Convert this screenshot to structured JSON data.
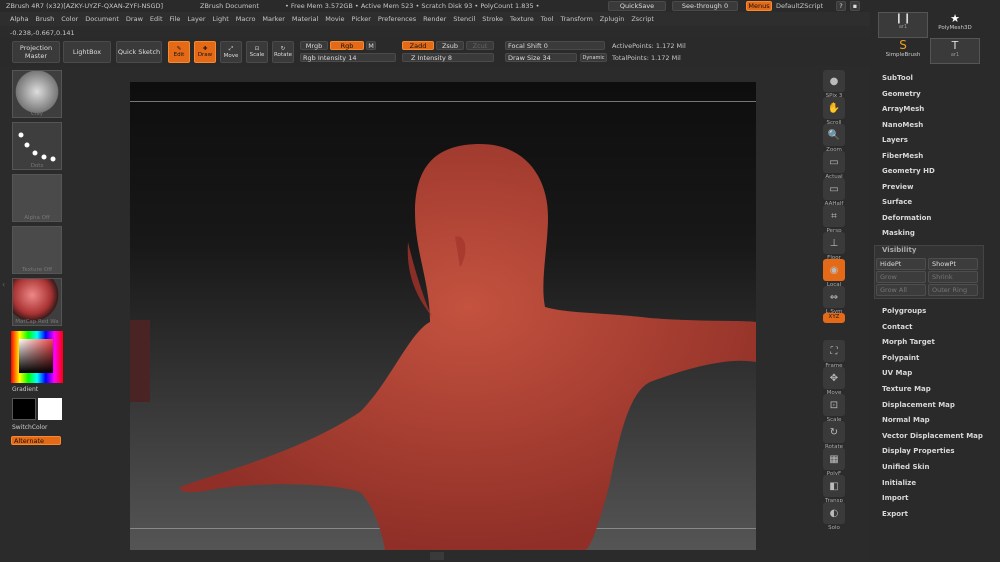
{
  "title": {
    "app": "ZBrush 4R7  (x32)[AZKY-UYZF-QXAN-ZYFI-NSGD]",
    "doc": "ZBrush Document",
    "stats": "• Free Mem 3.572GB • Active Mem 523 • Scratch Disk 93 • PolyCount 1.835 •",
    "quicksave": "QuickSave",
    "seethrough": "See-through  0",
    "menus": "Menus",
    "zscript": "DefaultZScript"
  },
  "menu": [
    "Alpha",
    "Brush",
    "Color",
    "Document",
    "Draw",
    "Edit",
    "File",
    "Layer",
    "Light",
    "Macro",
    "Marker",
    "Material",
    "Movie",
    "Picker",
    "Preferences",
    "Render",
    "Stencil",
    "Stroke",
    "Texture",
    "Tool",
    "Transform",
    "Zplugin",
    "Zscript"
  ],
  "coords": "-0.238,-0.667,0.141",
  "toolbar": {
    "projection": "Projection Master",
    "lightbox": "LightBox",
    "quicksketch": "Quick Sketch",
    "edit": "Edit",
    "draw": "Draw",
    "move": "Move",
    "scale": "Scale",
    "rotate": "Rotate",
    "mrgb": "Mrgb",
    "rgb": "Rgb",
    "m": "M",
    "rgb_intensity": "Rgb  Intensity 14",
    "zadd": "Zadd",
    "zsub": "Zsub",
    "zcut": "Zcut",
    "z_intensity": "Z  Intensity 8",
    "focal": "Focal Shift 0",
    "drawsize": "Draw Size 34",
    "dynamic": "Dynamic",
    "active_points": "ActivePoints: 1.172 Mil",
    "total_points": "TotalPoints: 1.172 Mil"
  },
  "left": {
    "thumbs": [
      "Clay",
      "Dots",
      "Alpha Off",
      "Texture Off",
      "MatCap Red Wa"
    ],
    "gradient": "Gradient",
    "switchcolor": "SwitchColor",
    "alternate": "Alternate"
  },
  "right_tools": [
    "SPix 3",
    "Scroll",
    "Zoom",
    "Actual",
    "AAHalf",
    "Persp",
    "Floor",
    "Local",
    "L.Sym",
    "XYZ",
    "Frame",
    "Move",
    "Scale",
    "Rotate",
    "PolyF",
    "Transp",
    "Solo"
  ],
  "tool_thumbs": [
    "ar1",
    "PolyMesh3D",
    "SimpleBrush",
    "ar1"
  ],
  "panel": {
    "items_top": [
      "SubTool",
      "Geometry",
      "ArrayMesh",
      "NanoMesh",
      "Layers",
      "FiberMesh",
      "Geometry HD",
      "Preview",
      "Surface",
      "Deformation",
      "Masking"
    ],
    "visibility": "Visibility",
    "hidept": "HidePt",
    "showpt": "ShowPt",
    "grow": "Grow",
    "shrink": "Shrink",
    "growall": "Grow All",
    "outerring": "Outer Ring",
    "items_bottom": [
      "Polygroups",
      "Contact",
      "Morph Target",
      "Polypaint",
      "UV Map",
      "Texture Map",
      "Displacement Map",
      "Normal Map",
      "Vector Displacement Map",
      "Display Properties",
      "Unified Skin",
      "Initialize",
      "Import",
      "Export"
    ]
  },
  "colors": {
    "accent": "#e46a17",
    "model": "#b9453c"
  }
}
